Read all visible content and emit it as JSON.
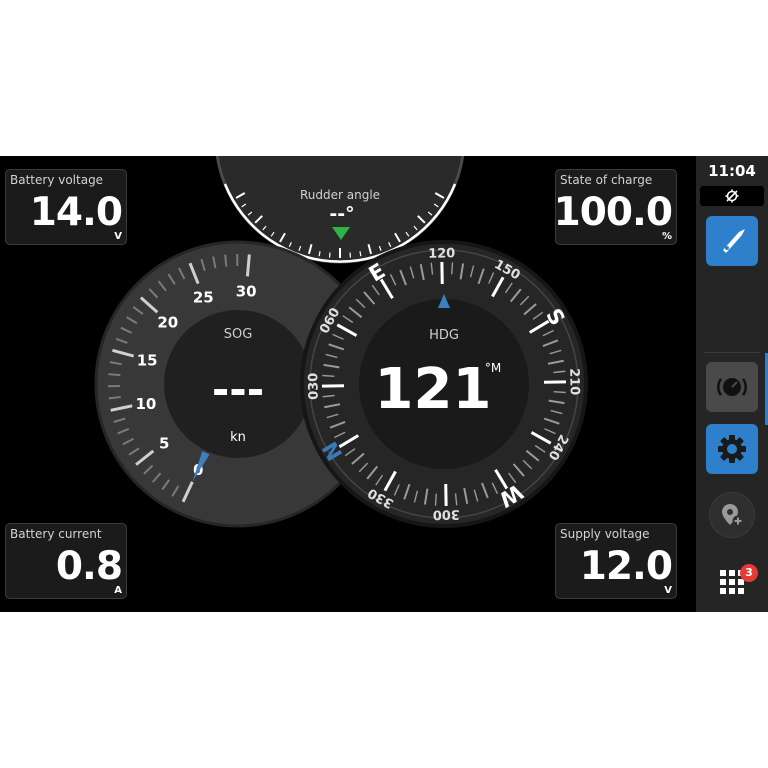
{
  "tiles": {
    "battery_voltage": {
      "label": "Battery voltage",
      "value": "14.0",
      "unit": "V"
    },
    "state_of_charge": {
      "label": "State of charge",
      "value": "100.0",
      "unit": "%"
    },
    "battery_current": {
      "label": "Battery current",
      "value": "0.8",
      "unit": "A"
    },
    "supply_voltage": {
      "label": "Supply voltage",
      "value": "12.0",
      "unit": "V"
    }
  },
  "rudder": {
    "label": "Rudder angle",
    "value": "--°",
    "indicator_color": "#2fb344"
  },
  "sog": {
    "label": "SOG",
    "value": "---",
    "unit": "kn",
    "scale_labels": [
      "0",
      "5",
      "10",
      "15",
      "20",
      "25",
      "30"
    ],
    "scale_max": 30,
    "current": 0
  },
  "hdg": {
    "label": "HDG",
    "value": "121",
    "unit": "°M",
    "heading_deg": 121,
    "cardinals": {
      "N": "N",
      "E": "E",
      "S": "S",
      "W": "W"
    },
    "degree_labels": [
      "030",
      "060",
      "120",
      "150",
      "210",
      "240",
      "300",
      "330"
    ],
    "north_color": "#3a7ab8"
  },
  "sidebar": {
    "time": "11:04",
    "apps_badge": "3",
    "icons": [
      "gps-off-icon",
      "navigation-icon",
      "gauge-icon",
      "settings-icon",
      "add-waypoint-icon",
      "apps-grid-icon"
    ]
  },
  "colors": {
    "accent": "#2f80cc",
    "background": "#000000",
    "tile": "#1b1b1b",
    "badge": "#e53935"
  }
}
